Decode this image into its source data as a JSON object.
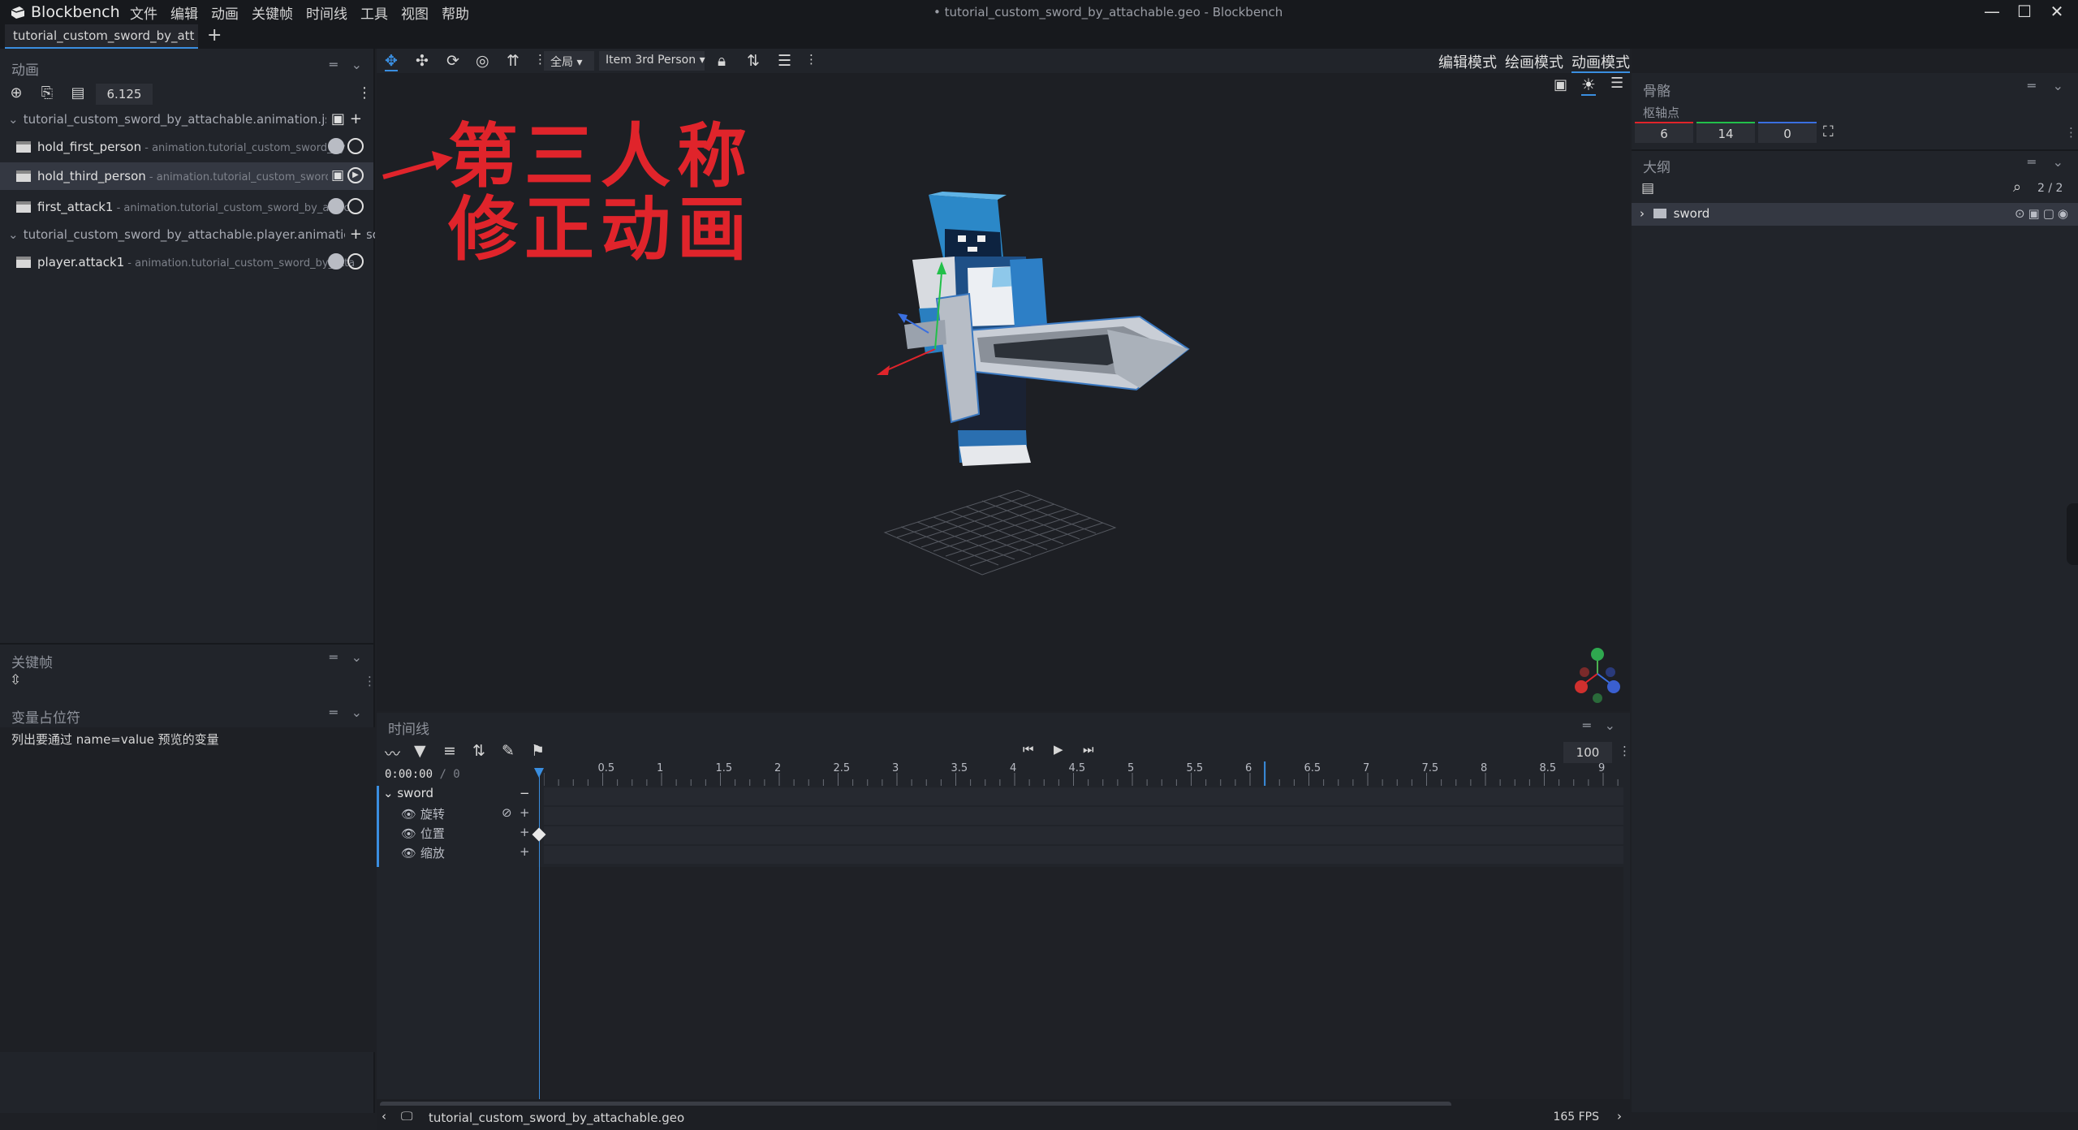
{
  "app": {
    "name": "Blockbench",
    "window_title": "• tutorial_custom_sword_by_attachable.geo - Blockbench",
    "menu": [
      "文件",
      "编辑",
      "动画",
      "关键帧",
      "时间线",
      "工具",
      "视图",
      "帮助"
    ]
  },
  "tab": {
    "label": "tutorial_custom_sword_by_att",
    "add": "+"
  },
  "left": {
    "animations_title": "动画",
    "time_value": "6.125",
    "files": [
      {
        "name": "tutorial_custom_sword_by_attachable.animation.json",
        "animations": [
          {
            "name": "hold_first_person",
            "sub": " - animation.tutorial_custom_sword_by",
            "selected": false
          },
          {
            "name": "hold_third_person",
            "sub": " - animation.tutorial_custom_sword_by",
            "selected": true
          },
          {
            "name": "first_attack1",
            "sub": " - animation.tutorial_custom_sword_by_attac",
            "selected": false
          }
        ]
      },
      {
        "name": "tutorial_custom_sword_by_attachable.player.animation.json",
        "animations": [
          {
            "name": "player.attack1",
            "sub": " - animation.tutorial_custom_sword_by_atta",
            "selected": false
          }
        ]
      }
    ],
    "keyframes_title": "关键帧",
    "variables_title": "变量占位符",
    "variables_hint": "列出要通过 name=value 预览的变量"
  },
  "annotation": {
    "line1": "第三人称",
    "line2": "修正动画",
    "color": "#e0242b"
  },
  "viewport": {
    "toolbar": {
      "space_label": "全局",
      "display_label": "Item 3rd Person"
    },
    "modes": [
      "编辑模式",
      "绘画模式",
      "动画模式"
    ],
    "active_mode": "动画模式"
  },
  "right": {
    "bone_title": "骨骼",
    "pivot_label": "枢轴点",
    "pivot": [
      "6",
      "14",
      "0"
    ],
    "outline_title": "大纲",
    "outline_count": "2 / 2",
    "outline_item": "sword"
  },
  "timeline": {
    "title": "时间线",
    "time": "0:00:00",
    "time_total": "/ 0",
    "zoom": "100",
    "ticks": [
      "0.5",
      "1",
      "1.5",
      "2",
      "2.5",
      "3",
      "3.5",
      "4",
      "4.5",
      "5",
      "5.5",
      "6",
      "6.5",
      "7",
      "7.5",
      "8",
      "8.5",
      "9"
    ],
    "bone": "sword",
    "channels": [
      "旋转",
      "位置",
      "缩放"
    ],
    "keyframe_channel": "位置",
    "keyframe_time": 0,
    "marker_time": 6.125
  },
  "status": {
    "file": "tutorial_custom_sword_by_attachable.geo",
    "fps": "165 FPS"
  },
  "colors": {
    "accent": "#3a8ee0",
    "bg": "#1e2025",
    "panel": "#21242a"
  }
}
